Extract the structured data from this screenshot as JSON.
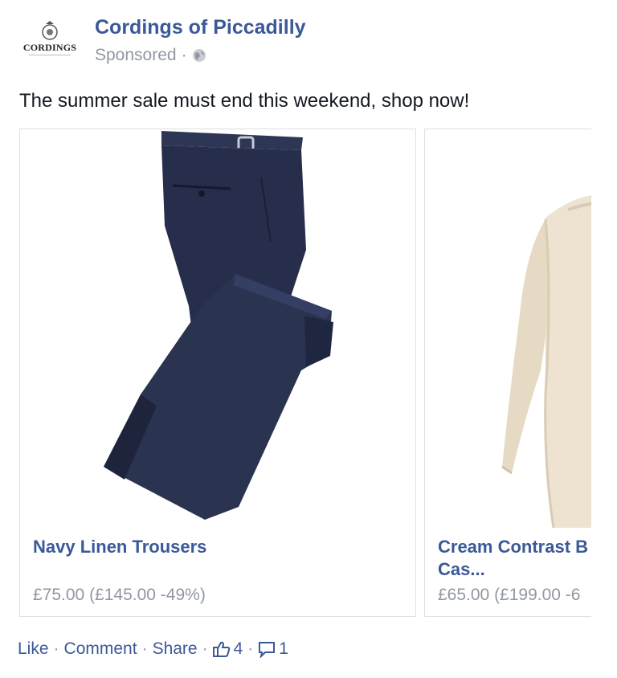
{
  "post": {
    "page_name": "Cordings of Piccadilly",
    "sponsored_label": "Sponsored",
    "meta_separator": "·",
    "logo_text": "CORDINGS",
    "message": "The summer sale must end this weekend, shop now!"
  },
  "carousel": {
    "cards": [
      {
        "title": "Navy Linen Trousers",
        "price": "£75.00 (£145.00 -49%)",
        "image_icon": "navy-trousers-image"
      },
      {
        "title": "Cream Contrast B Cas...",
        "price": "£65.00 (£199.00 -6",
        "image_icon": "cream-sweater-image"
      }
    ]
  },
  "actions": {
    "like_label": "Like",
    "comment_label": "Comment",
    "share_label": "Share",
    "separator": "·",
    "like_count": "4",
    "comment_count": "1"
  },
  "colors": {
    "link_blue": "#3b5998",
    "meta_gray": "#9197a3",
    "navy": "#2a3350",
    "cream": "#efe6d6"
  }
}
